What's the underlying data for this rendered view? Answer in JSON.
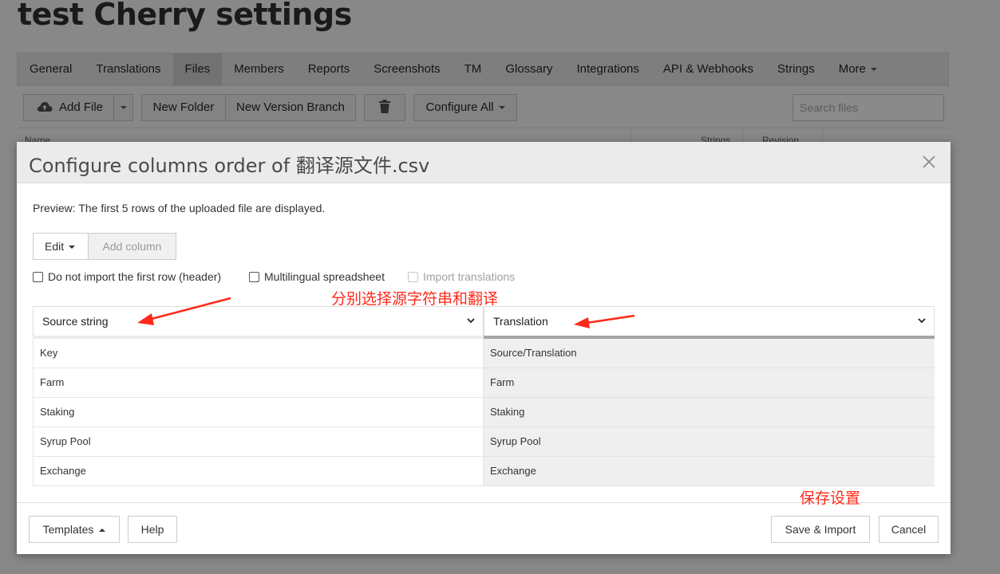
{
  "page": {
    "title": "test Cherry settings"
  },
  "tabs": [
    {
      "label": "General"
    },
    {
      "label": "Translations"
    },
    {
      "label": "Files",
      "active": true
    },
    {
      "label": "Members"
    },
    {
      "label": "Reports"
    },
    {
      "label": "Screenshots"
    },
    {
      "label": "TM"
    },
    {
      "label": "Glossary"
    },
    {
      "label": "Integrations"
    },
    {
      "label": "API & Webhooks"
    },
    {
      "label": "Strings"
    },
    {
      "label": "More"
    }
  ],
  "toolbar": {
    "add_file": "Add File",
    "new_folder": "New Folder",
    "new_version_branch": "New Version Branch",
    "configure_all": "Configure All",
    "search_placeholder": "Search files"
  },
  "table_head": {
    "name": "Name",
    "strings": "Strings",
    "revision": "Revision"
  },
  "modal": {
    "title": "Configure columns order of 翻译源文件.csv",
    "preview_text": "Preview: The first 5 rows of the uploaded file are displayed.",
    "edit_label": "Edit",
    "add_column_label": "Add column",
    "checkboxes": {
      "no_header": "Do not import the first row (header)",
      "multilingual": "Multilingual spreadsheet",
      "import_translations": "Import translations"
    },
    "columns": [
      {
        "selected": "Source string",
        "accent": "#ececec"
      },
      {
        "selected": "Translation",
        "accent": "#a4a4a4"
      }
    ],
    "rows": [
      [
        "Key",
        "Source/Translation"
      ],
      [
        "Farm",
        "Farm"
      ],
      [
        "Staking",
        "Staking"
      ],
      [
        "Syrup Pool",
        "Syrup Pool"
      ],
      [
        "Exchange",
        "Exchange"
      ]
    ],
    "footer": {
      "templates": "Templates",
      "help": "Help",
      "save_import": "Save & Import",
      "cancel": "Cancel"
    }
  },
  "annotations": {
    "select_hint": "分别选择源字符串和翻译",
    "save_hint": "保存设置",
    "color": "#ff2a1a"
  }
}
